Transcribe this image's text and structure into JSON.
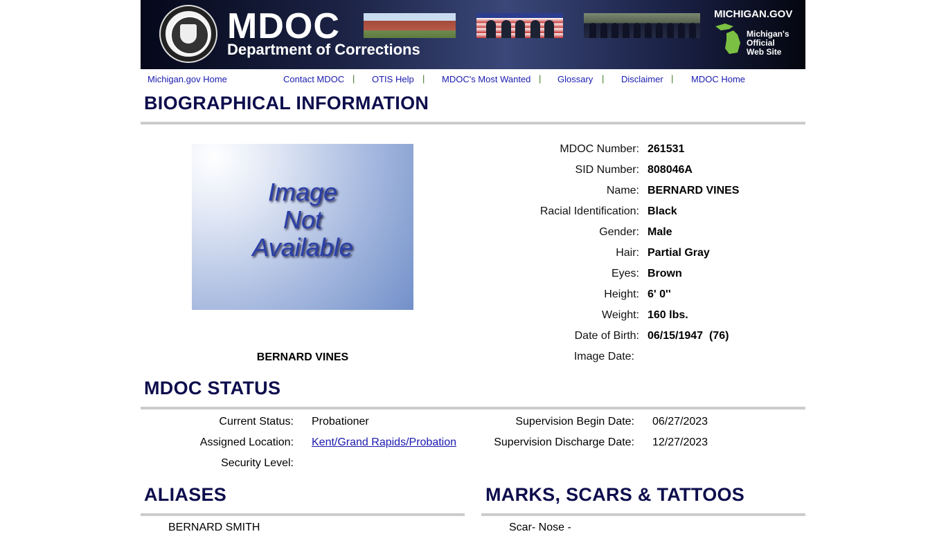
{
  "banner": {
    "logo_text": "MDOC",
    "logo_subtitle": "Department of Corrections",
    "michigan_title": "MICHIGAN.GOV",
    "michigan_tagline": [
      "Michigan's",
      "Official",
      "Web Site"
    ]
  },
  "nav": {
    "items": [
      {
        "label": "Michigan.gov Home"
      },
      {
        "label": "Contact MDOC"
      },
      {
        "label": "OTIS Help"
      },
      {
        "label": "MDOC's Most Wanted"
      },
      {
        "label": "Glossary"
      },
      {
        "label": "Disclaimer"
      },
      {
        "label": "MDOC Home"
      }
    ],
    "separator": "|"
  },
  "bio": {
    "title": "BIOGRAPHICAL INFORMATION",
    "image_placeholder": [
      "Image",
      "Not",
      "Available"
    ],
    "caption_name": "BERNARD VINES",
    "fields": [
      {
        "label": "MDOC Number:",
        "value": "261531"
      },
      {
        "label": "SID Number:",
        "value": "808046A"
      },
      {
        "label": "Name:",
        "value": "BERNARD VINES"
      },
      {
        "label": "Racial Identification:",
        "value": "Black"
      },
      {
        "label": "Gender:",
        "value": "Male"
      },
      {
        "label": "Hair:",
        "value": "Partial Gray"
      },
      {
        "label": "Eyes:",
        "value": "Brown"
      },
      {
        "label": "Height:",
        "value": "6' 0''"
      },
      {
        "label": "Weight:",
        "value": "160 lbs."
      },
      {
        "label": "Date of Birth:",
        "value": "06/15/1947  (76)"
      }
    ],
    "image_date_label": "Image Date:"
  },
  "status": {
    "title": "MDOC STATUS",
    "current_status_label": "Current Status:",
    "current_status_value": "Probationer",
    "assigned_location_label": "Assigned Location:",
    "assigned_location_value": "Kent/Grand Rapids/Probation",
    "security_level_label": "Security Level:",
    "supervision_begin_label": "Supervision Begin Date:",
    "supervision_begin_value": "06/27/2023",
    "supervision_discharge_label": "Supervision Discharge Date:",
    "supervision_discharge_value": "12/27/2023"
  },
  "aliases": {
    "title": "ALIASES",
    "items": [
      "BERNARD SMITH"
    ]
  },
  "marks": {
    "title": "MARKS, SCARS & TATTOOS",
    "items": [
      "Scar- Nose -"
    ]
  },
  "colors": {
    "heading": "#0d0d4d",
    "link": "#1a1ab0",
    "rule": "#cccccc",
    "nav_separator": "#3f7a1f"
  }
}
